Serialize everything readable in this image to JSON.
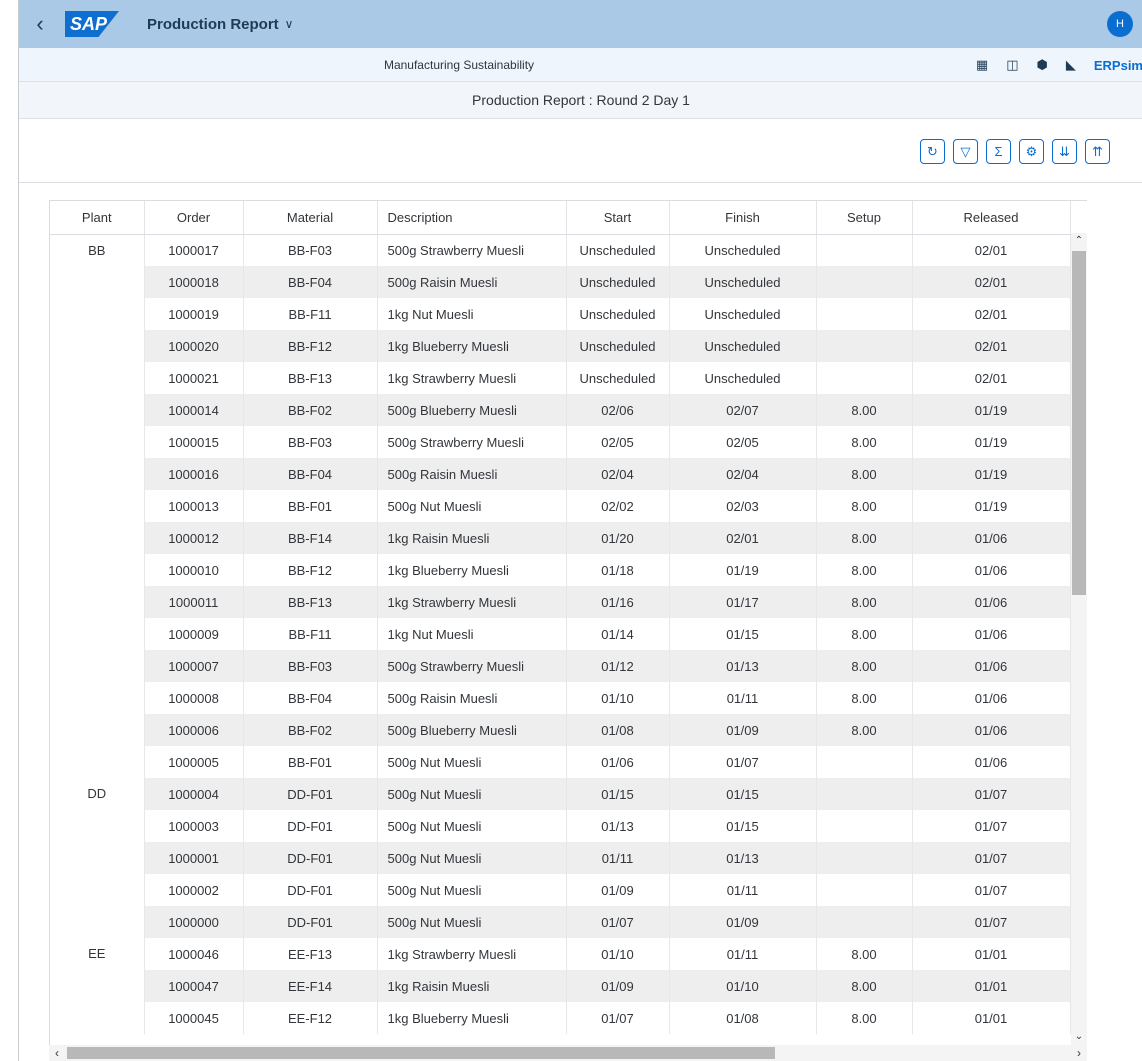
{
  "shell": {
    "logo": "SAP",
    "app_title": "Production Report",
    "avatar_initial": "H"
  },
  "subheader": {
    "title": "Manufacturing Sustainability",
    "brand": "ERPsim"
  },
  "page": {
    "title": "Production Report : Round 2 Day 1"
  },
  "toolbar": {
    "buttons": [
      "refresh-icon",
      "filter-icon",
      "sum-icon",
      "settings-icon",
      "expand-all-icon",
      "collapse-all-icon"
    ]
  },
  "table": {
    "columns": [
      "Plant",
      "Order",
      "Material",
      "Description",
      "Start",
      "Finish",
      "Setup",
      "Released"
    ],
    "groups": [
      {
        "plant": "BB",
        "rows": [
          [
            "1000017",
            "BB-F03",
            "500g Strawberry Muesli",
            "Unscheduled",
            "Unscheduled",
            "",
            "02/01"
          ],
          [
            "1000018",
            "BB-F04",
            "500g Raisin Muesli",
            "Unscheduled",
            "Unscheduled",
            "",
            "02/01"
          ],
          [
            "1000019",
            "BB-F11",
            "1kg Nut Muesli",
            "Unscheduled",
            "Unscheduled",
            "",
            "02/01"
          ],
          [
            "1000020",
            "BB-F12",
            "1kg Blueberry Muesli",
            "Unscheduled",
            "Unscheduled",
            "",
            "02/01"
          ],
          [
            "1000021",
            "BB-F13",
            "1kg Strawberry Muesli",
            "Unscheduled",
            "Unscheduled",
            "",
            "02/01"
          ],
          [
            "1000014",
            "BB-F02",
            "500g Blueberry Muesli",
            "02/06",
            "02/07",
            "8.00",
            "01/19"
          ],
          [
            "1000015",
            "BB-F03",
            "500g Strawberry Muesli",
            "02/05",
            "02/05",
            "8.00",
            "01/19"
          ],
          [
            "1000016",
            "BB-F04",
            "500g Raisin Muesli",
            "02/04",
            "02/04",
            "8.00",
            "01/19"
          ],
          [
            "1000013",
            "BB-F01",
            "500g Nut Muesli",
            "02/02",
            "02/03",
            "8.00",
            "01/19"
          ],
          [
            "1000012",
            "BB-F14",
            "1kg Raisin Muesli",
            "01/20",
            "02/01",
            "8.00",
            "01/06"
          ],
          [
            "1000010",
            "BB-F12",
            "1kg Blueberry Muesli",
            "01/18",
            "01/19",
            "8.00",
            "01/06"
          ],
          [
            "1000011",
            "BB-F13",
            "1kg Strawberry Muesli",
            "01/16",
            "01/17",
            "8.00",
            "01/06"
          ],
          [
            "1000009",
            "BB-F11",
            "1kg Nut Muesli",
            "01/14",
            "01/15",
            "8.00",
            "01/06"
          ],
          [
            "1000007",
            "BB-F03",
            "500g Strawberry Muesli",
            "01/12",
            "01/13",
            "8.00",
            "01/06"
          ],
          [
            "1000008",
            "BB-F04",
            "500g Raisin Muesli",
            "01/10",
            "01/11",
            "8.00",
            "01/06"
          ],
          [
            "1000006",
            "BB-F02",
            "500g Blueberry Muesli",
            "01/08",
            "01/09",
            "8.00",
            "01/06"
          ],
          [
            "1000005",
            "BB-F01",
            "500g Nut Muesli",
            "01/06",
            "01/07",
            "",
            "01/06"
          ]
        ]
      },
      {
        "plant": "DD",
        "rows": [
          [
            "1000004",
            "DD-F01",
            "500g Nut Muesli",
            "01/15",
            "01/15",
            "",
            "01/07"
          ],
          [
            "1000003",
            "DD-F01",
            "500g Nut Muesli",
            "01/13",
            "01/15",
            "",
            "01/07"
          ],
          [
            "1000001",
            "DD-F01",
            "500g Nut Muesli",
            "01/11",
            "01/13",
            "",
            "01/07"
          ],
          [
            "1000002",
            "DD-F01",
            "500g Nut Muesli",
            "01/09",
            "01/11",
            "",
            "01/07"
          ],
          [
            "1000000",
            "DD-F01",
            "500g Nut Muesli",
            "01/07",
            "01/09",
            "",
            "01/07"
          ]
        ]
      },
      {
        "plant": "EE",
        "rows": [
          [
            "1000046",
            "EE-F13",
            "1kg Strawberry Muesli",
            "01/10",
            "01/11",
            "8.00",
            "01/01"
          ],
          [
            "1000047",
            "EE-F14",
            "1kg Raisin Muesli",
            "01/09",
            "01/10",
            "8.00",
            "01/01"
          ],
          [
            "1000045",
            "EE-F12",
            "1kg Blueberry Muesli",
            "01/07",
            "01/08",
            "8.00",
            "01/01"
          ]
        ]
      }
    ]
  }
}
